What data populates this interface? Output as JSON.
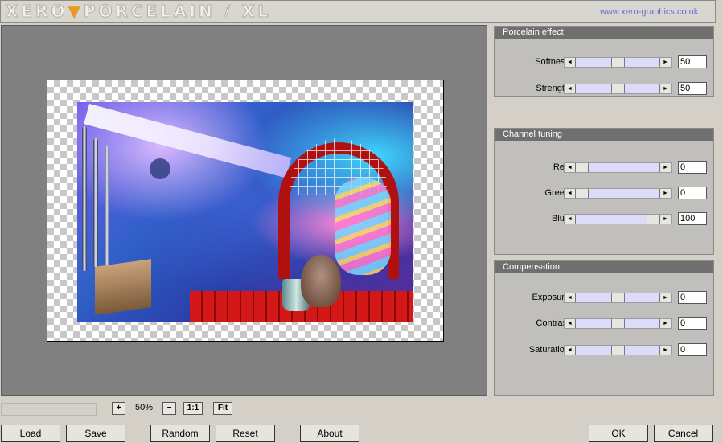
{
  "header": {
    "logo_part1": "XERO",
    "logo_triangle": "▼",
    "logo_part2": "PORCELAIN / XL",
    "site_url": "www.xero-graphics.co.uk"
  },
  "zoom": {
    "plus_label": "+",
    "value": "50%",
    "minus_label": "−",
    "actual_size_label": "1:1",
    "fit_label": "Fit"
  },
  "buttons": {
    "load": "Load",
    "save": "Save",
    "random": "Random",
    "reset": "Reset",
    "about": "About",
    "ok": "OK",
    "cancel": "Cancel"
  },
  "icons": {
    "slider_left": "arrow-left-icon",
    "slider_right": "arrow-right-icon"
  },
  "panels": {
    "porcelain": {
      "title": "Porcelain effect",
      "softness": {
        "label": "Softness",
        "value": "50",
        "level": 0.5
      },
      "strength": {
        "label": "Strength",
        "value": "50",
        "level": 0.5
      }
    },
    "channel": {
      "title": "Channel tuning",
      "red": {
        "label": "Red",
        "value": "0",
        "level": 0.0
      },
      "green": {
        "label": "Green",
        "value": "0",
        "level": 0.0
      },
      "blue": {
        "label": "Blue",
        "value": "100",
        "level": 1.0
      }
    },
    "compensation": {
      "title": "Compensation",
      "exposure": {
        "label": "Exposure",
        "value": "0",
        "level": 0.5
      },
      "contrast": {
        "label": "Contrast",
        "value": "0",
        "level": 0.5
      },
      "saturation": {
        "label": "Saturation",
        "value": "0",
        "level": 0.5
      }
    }
  }
}
